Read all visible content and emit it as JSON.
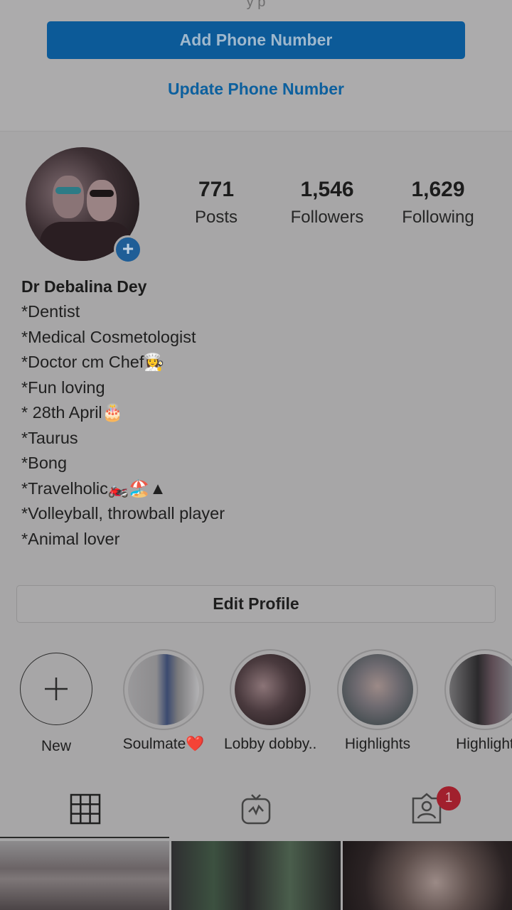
{
  "phone": {
    "cut_text": "y p",
    "add_label": "Add Phone Number",
    "update_label": "Update Phone Number"
  },
  "profile": {
    "stats": [
      {
        "num": "771",
        "label": "Posts"
      },
      {
        "num": "1,546",
        "label": "Followers"
      },
      {
        "num": "1,629",
        "label": "Following"
      }
    ],
    "name": "Dr Debalina Dey",
    "bio": [
      "*Dentist",
      "*Medical Cosmetologist",
      "*Doctor cm Chef👩‍🍳",
      "*Fun loving",
      "* 28th April🎂",
      "*Taurus",
      "*Bong",
      "*Travelholic🏍️🏖️▲",
      "*Volleyball, throwball player",
      "*Animal lover"
    ],
    "edit_label": "Edit Profile"
  },
  "highlights": [
    {
      "label": "New",
      "icon": "plus-icon"
    },
    {
      "label": "Soulmate❤️"
    },
    {
      "label": "Lobby dobby..."
    },
    {
      "label": "Highlights"
    },
    {
      "label": "Highlight"
    }
  ],
  "tabs": {
    "icons": [
      "grid-icon",
      "igtv-icon",
      "tagged-icon"
    ],
    "notification_count": "1"
  },
  "colors": {
    "accent": "#0c5a98",
    "badge": "#a1202d"
  }
}
